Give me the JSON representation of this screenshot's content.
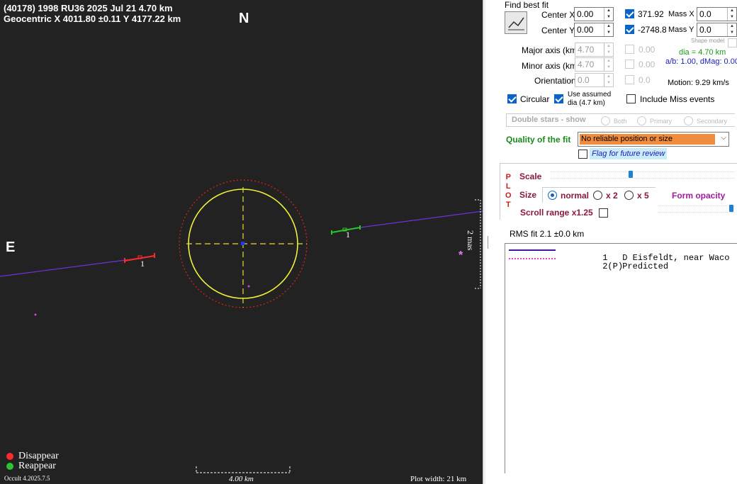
{
  "plot": {
    "header_line1": "(40178) 1998 RU36  2025 Jul 21   4.70 km",
    "header_line2": "Geocentric  X  4011.80 ±0.11  Y 4177.22 km",
    "north": "N",
    "east": "E",
    "chord_label_left": "1",
    "chord_label_right": "1",
    "mas_label": "2 mas",
    "star_symbol": "*",
    "legend_disappear": "Disappear",
    "legend_reappear": "Reappear",
    "version": "Occult 4.2025.7.5",
    "scale_bar_label": "4.00 km",
    "plot_width_label": "Plot width: 21 km",
    "colors": {
      "background": "#222222",
      "disappear": "#ff2a2a",
      "reappear": "#2ec42e",
      "ellipse": "#f0f03c",
      "axes": "#e6dc32",
      "limit": "#d81e1e",
      "chord": "#6a34d8",
      "predicted": "#e040e0"
    }
  },
  "panel": {
    "find_best_fit": "Find best fit",
    "fit_icon": "chart-line-icon",
    "center_x_label": "Center X",
    "center_x_value": "0.00",
    "center_y_label": "Center Y",
    "center_y_value": "0.00",
    "fit_x_value": "371.92",
    "fit_y_value": "-2748.8(",
    "mass_x_label": "Mass X",
    "mass_x_value": "0.0",
    "mass_y_label": "Mass Y",
    "mass_y_value": "0.0",
    "shape_model": "Shape model",
    "major_label": "Major axis (km)",
    "major_value": "4.70",
    "major_fit": "0.00",
    "minor_label": "Minor axis (km)",
    "minor_value": "4.70",
    "minor_fit": "0.00",
    "orient_label": "Orientation",
    "orient_value": "0.0",
    "orient_fit": "0.0",
    "dia_text": "dia = 4.70 km",
    "ab_text": "a/b: 1.00, dMag: 0.00",
    "motion_text": "Motion: 9.29 km/s",
    "circular_label": "Circular",
    "use_assumed_label1": "Use assumed",
    "use_assumed_label2": "dia (4.7 km)",
    "include_miss_label": "Include Miss events",
    "double_stars_label": "Double stars - show",
    "both_label": "Both",
    "primary_label": "Primary",
    "secondary_label": "Secondary",
    "quality_label": "Quality of the fit",
    "quality_value": "No reliable position or size",
    "flag_label": "Flag for future review",
    "plot_letters": [
      "P",
      "L",
      "O",
      "T"
    ],
    "scale_label": "Scale",
    "size_label": "Size",
    "size_normal": "normal",
    "size_x2": "x 2",
    "size_x5": "x 5",
    "form_opacity_label": "Form opacity",
    "scroll_range_label": "Scroll range x1.25",
    "rms_label": "RMS fit 2.1 ±0.0 km",
    "legend_rows": [
      {
        "num": "1",
        "name": "D Eisfeldt, near Waco"
      },
      {
        "num": "2(P)",
        "name": "Predicted"
      }
    ]
  }
}
